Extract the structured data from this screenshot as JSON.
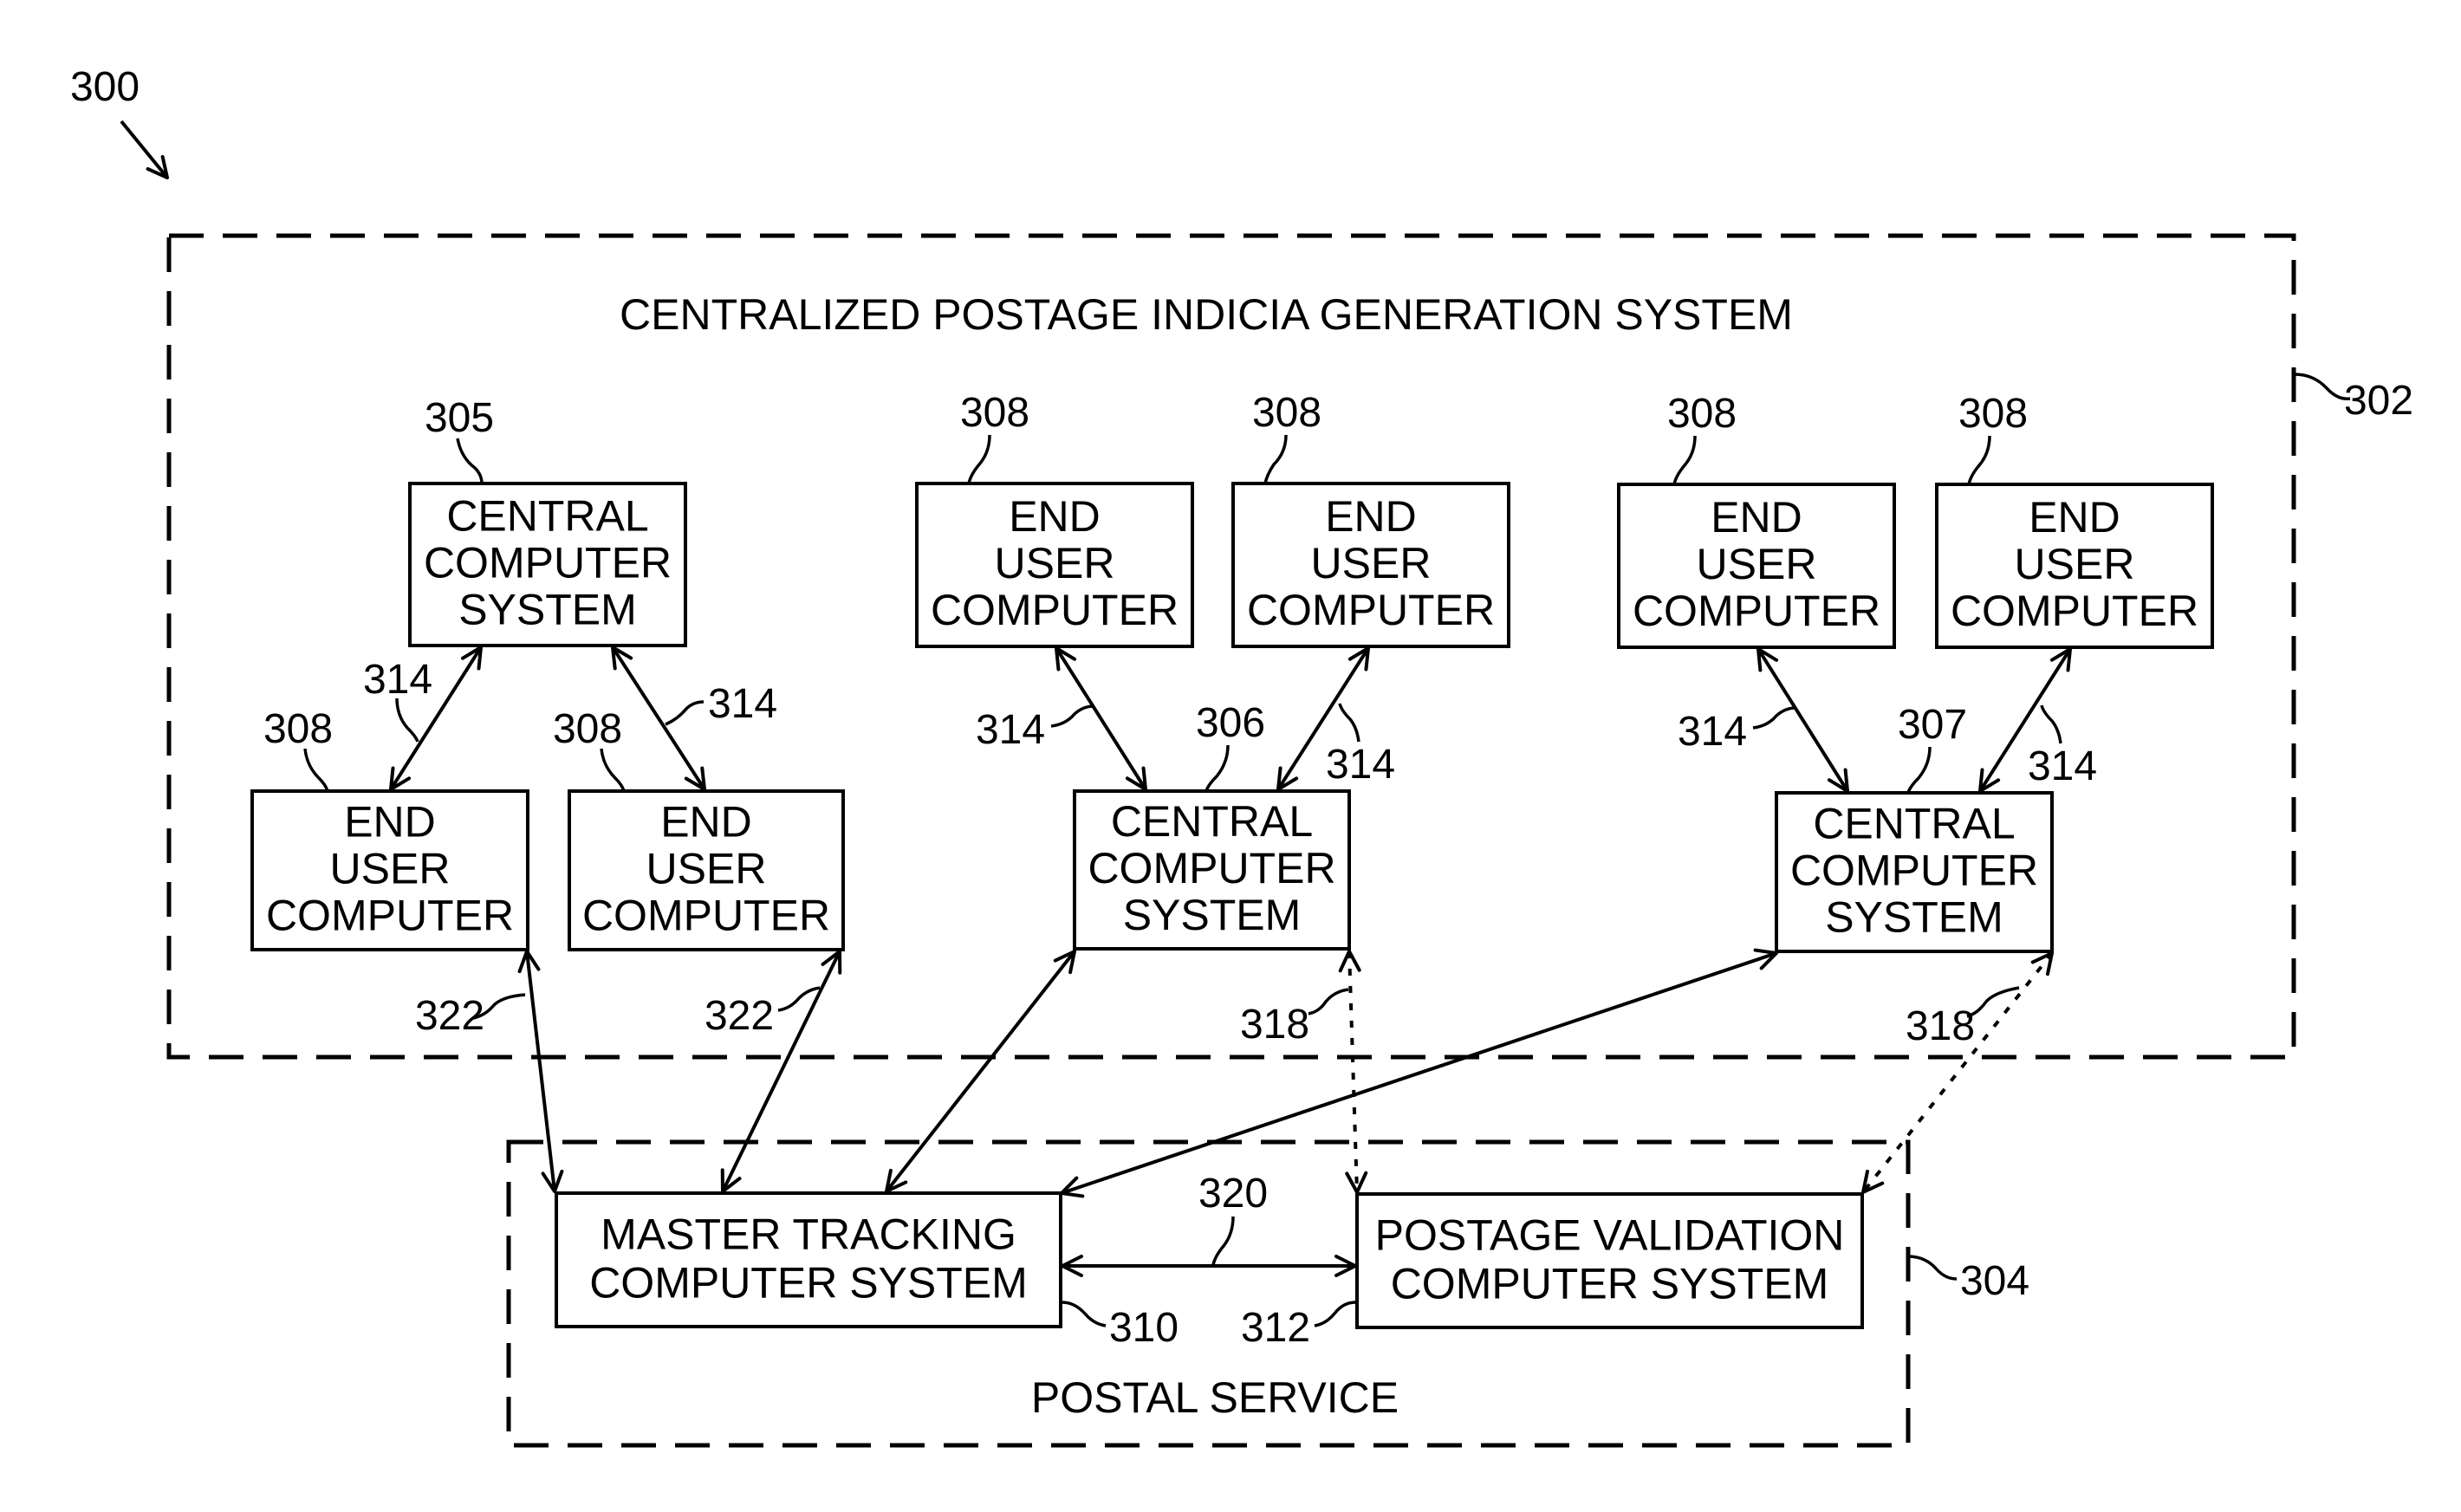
{
  "figure": {
    "reference": "300",
    "groups": [
      {
        "id": "302",
        "title": "CENTRALIZED POSTAGE INDICIA GENERATION SYSTEM",
        "reference": "302",
        "border": "dashed"
      },
      {
        "id": "304",
        "title": "POSTAL SERVICE",
        "reference": "304",
        "border": "dashed"
      }
    ],
    "nodes": [
      {
        "id": "central-305",
        "lines": [
          "CENTRAL",
          "COMPUTER",
          "SYSTEM"
        ],
        "reference": "305",
        "group": "302"
      },
      {
        "id": "eu-1",
        "lines": [
          "END",
          "USER",
          "COMPUTER"
        ],
        "reference": "308",
        "group": "302"
      },
      {
        "id": "eu-2",
        "lines": [
          "END",
          "USER",
          "COMPUTER"
        ],
        "reference": "308",
        "group": "302"
      },
      {
        "id": "eu-3",
        "lines": [
          "END",
          "USER",
          "COMPUTER"
        ],
        "reference": "308",
        "group": "302"
      },
      {
        "id": "eu-4",
        "lines": [
          "END",
          "USER",
          "COMPUTER"
        ],
        "reference": "308",
        "group": "302"
      },
      {
        "id": "central-306",
        "lines": [
          "CENTRAL",
          "COMPUTER",
          "SYSTEM"
        ],
        "reference": "306",
        "group": "302"
      },
      {
        "id": "eu-5",
        "lines": [
          "END",
          "USER",
          "COMPUTER"
        ],
        "reference": "308",
        "group": "302"
      },
      {
        "id": "eu-6",
        "lines": [
          "END",
          "USER",
          "COMPUTER"
        ],
        "reference": "308",
        "group": "302"
      },
      {
        "id": "central-307",
        "lines": [
          "CENTRAL",
          "COMPUTER",
          "SYSTEM"
        ],
        "reference": "307",
        "group": "302"
      },
      {
        "id": "master-310",
        "lines": [
          "MASTER TRACKING",
          "COMPUTER SYSTEM"
        ],
        "reference": "310",
        "group": "304"
      },
      {
        "id": "validation-312",
        "lines": [
          "POSTAGE VALIDATION",
          "COMPUTER SYSTEM"
        ],
        "reference": "312",
        "group": "304"
      }
    ],
    "connections": [
      {
        "from": "central-305",
        "to": "eu-1",
        "reference": "314",
        "style": "solid",
        "arrows": "both"
      },
      {
        "from": "central-305",
        "to": "eu-2",
        "reference": "314",
        "style": "solid",
        "arrows": "both"
      },
      {
        "from": "eu-3",
        "to": "central-306",
        "reference": "314",
        "style": "solid",
        "arrows": "both"
      },
      {
        "from": "eu-4",
        "to": "central-306",
        "reference": "314",
        "style": "solid",
        "arrows": "both"
      },
      {
        "from": "eu-5",
        "to": "central-307",
        "reference": "314",
        "style": "solid",
        "arrows": "both"
      },
      {
        "from": "eu-6",
        "to": "central-307",
        "reference": "314",
        "style": "solid",
        "arrows": "both"
      },
      {
        "from": "eu-1",
        "to": "master-310",
        "reference": "322",
        "style": "solid",
        "arrows": "both"
      },
      {
        "from": "eu-2",
        "to": "master-310",
        "reference": "322",
        "style": "solid",
        "arrows": "both"
      },
      {
        "from": "central-306",
        "to": "master-310",
        "reference": "",
        "style": "solid",
        "arrows": "both"
      },
      {
        "from": "central-307",
        "to": "master-310",
        "reference": "",
        "style": "solid",
        "arrows": "both"
      },
      {
        "from": "central-306",
        "to": "validation-312",
        "reference": "318",
        "style": "dotted",
        "arrows": "both"
      },
      {
        "from": "central-307",
        "to": "validation-312",
        "reference": "318",
        "style": "dotted",
        "arrows": "both"
      },
      {
        "from": "master-310",
        "to": "validation-312",
        "reference": "320",
        "style": "solid",
        "arrows": "both"
      }
    ]
  }
}
